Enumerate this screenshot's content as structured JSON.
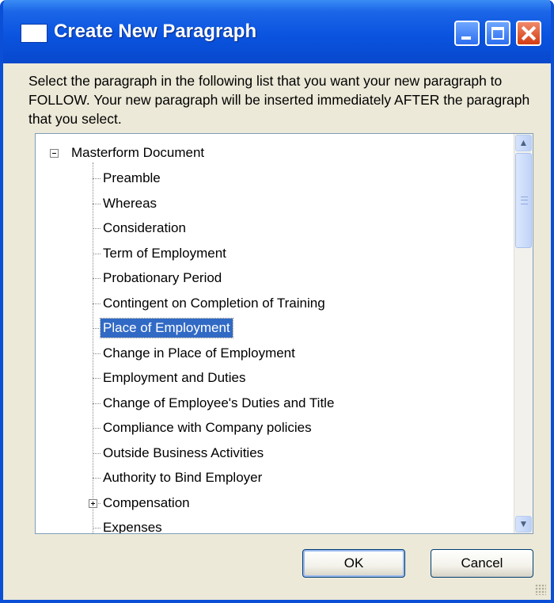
{
  "window": {
    "title": "Create New Paragraph",
    "icon": "window-icon",
    "controls": [
      "minimize",
      "maximize",
      "close"
    ]
  },
  "instructions": "Select the paragraph in the following list that you want your new paragraph to FOLLOW. Your new paragraph will be inserted immediately AFTER the paragraph that you select.",
  "tree": {
    "root": {
      "label": "Masterform Document",
      "expanded": true
    },
    "children": [
      {
        "label": "Preamble"
      },
      {
        "label": "Whereas"
      },
      {
        "label": "Consideration"
      },
      {
        "label": "Term of Employment"
      },
      {
        "label": "Probationary Period"
      },
      {
        "label": "Contingent on Completion of Training"
      },
      {
        "label": "Place of Employment",
        "selected": true
      },
      {
        "label": "Change in Place of Employment"
      },
      {
        "label": "Employment and Duties"
      },
      {
        "label": "Change of Employee's Duties and Title"
      },
      {
        "label": "Compliance with Company policies"
      },
      {
        "label": "Outside Business Activities"
      },
      {
        "label": "Authority to Bind Employer"
      },
      {
        "label": "Compensation",
        "collapsed": true
      },
      {
        "label": "Expenses"
      }
    ]
  },
  "buttons": {
    "ok": "OK",
    "cancel": "Cancel"
  },
  "colors": {
    "titlebar": "#0a54e0",
    "selection": "#316ac5",
    "dialog_bg": "#ece9d8"
  }
}
